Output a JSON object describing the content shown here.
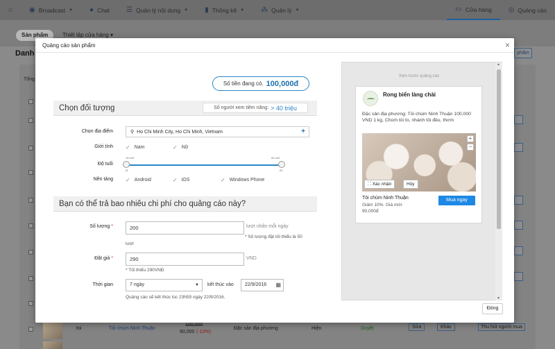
{
  "topnav": {
    "items": [
      {
        "label": "",
        "icon": "home-icon"
      },
      {
        "label": "Broadcast",
        "icon": "broadcast-icon"
      },
      {
        "label": "Chat",
        "icon": "chat-icon"
      },
      {
        "label": "Quản lý nội dung",
        "icon": "list-icon"
      },
      {
        "label": "Thống kê",
        "icon": "chart-icon"
      },
      {
        "label": "Quản lý",
        "icon": "grid-icon"
      }
    ],
    "right_items": [
      {
        "label": "Cửa hàng",
        "icon": "store-icon"
      },
      {
        "label": "Quảng cáo",
        "icon": "ads-icon"
      }
    ]
  },
  "subtabs": {
    "active": "Sản phẩm",
    "other": "Thiết lập cửa hàng"
  },
  "page": {
    "title": "Danh s",
    "right_button": "phẩm",
    "left_label": "Tổng"
  },
  "bottom_row": {
    "col1": "toi",
    "name": "Tỏi chùm Ninh Thuận",
    "old_price": "100,000",
    "new_price": "90,000",
    "discount": "(-10%)",
    "category": "Đặc sản địa phương",
    "visibility": "Hiện",
    "status": "Duyệt",
    "edit": "Sửa",
    "more": "Khác",
    "promote": "Thu hút người mua"
  },
  "modal": {
    "title": "Quảng cáo sản phẩm",
    "balance_label": "Số tiền đang có.",
    "balance_value": "100,000đ",
    "audience": {
      "heading": "Chọn đối tượng",
      "reach_label": "Số người xem tiềm năng:",
      "reach_value": "> 40 triệu",
      "location_label": "Chọn địa điểm",
      "location_value": "Ho Chi Minh City, Ho Chi Minh, Vietnam",
      "gender_label": "Giới tính",
      "gender_options": [
        "Nam",
        "Nữ"
      ],
      "age_label": "Độ tuổi",
      "age_min": "18",
      "age_max": "65",
      "age_min_cap": "18 tuổi",
      "age_max_cap": "65 tuổi",
      "platform_label": "Nền tảng",
      "platform_options": [
        "Android",
        "iOS",
        "Windows Phone"
      ]
    },
    "budget": {
      "heading": "Bạn có thể trả bao nhiêu chi phí cho quảng cáo này?",
      "qty_label": "Số lượng",
      "qty_value": "200",
      "qty_unit": "lượt nhấn mỗi ngày",
      "qty_note": "* Số lượng đặt tối thiểu là 50",
      "qty_note2": "lượt",
      "price_label": "Đặt giá",
      "price_value": "290",
      "price_unit": "VND",
      "price_note": "* Tối thiểu 290VNĐ",
      "time_label": "Thời gian",
      "time_value": "7 ngày",
      "end_label": "kết thúc vào",
      "end_date": "22/9/2016",
      "end_note": "Quảng cáo sẽ kết thúc lúc 23h59 ngày 22/9/2016.",
      "required_mark": "*"
    },
    "preview": {
      "caption": "Xem trước quảng cáo",
      "shop_name": "Rong biển làng chài",
      "description": "Đặc sản địa phương: Tỏi chùm Ninh Thuận 100,000 VND 1 kg, Chùm tỏi to, nhánh tỏi đều, thơm",
      "accept_label": "Xác nhận",
      "cancel_label": "Hủy",
      "product_name": "Tỏi chùm Ninh Thuận",
      "discount_text": "Giảm 10%. Giá mới:",
      "new_price": "90,000đ",
      "buy_label": "Mua ngay"
    },
    "close_label": "Đóng"
  }
}
